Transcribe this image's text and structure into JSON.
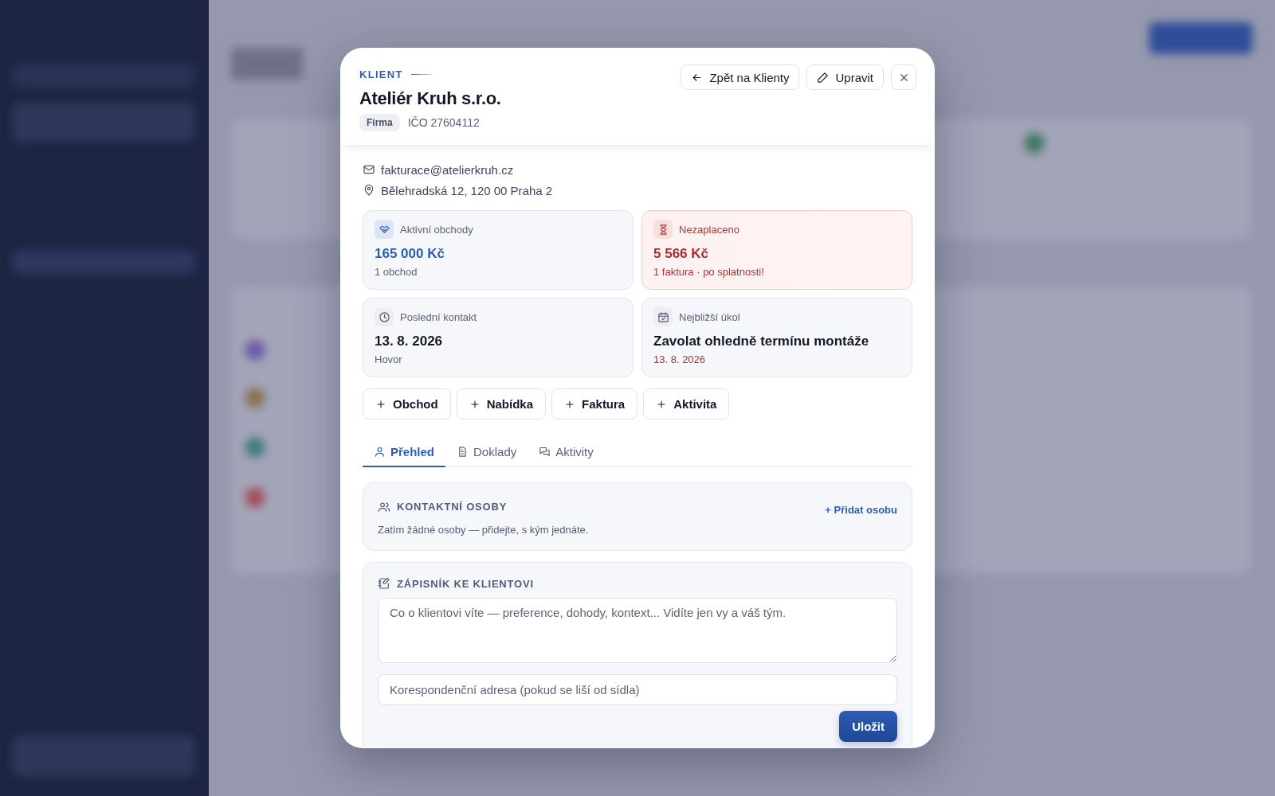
{
  "header": {
    "eyebrow": "KLIENT",
    "title": "Ateliér Kruh s.r.o.",
    "type_badge": "Firma",
    "ico": "IČO 27604112",
    "buttons": [
      {
        "kind": "back",
        "label": "Zpět na Klienty"
      },
      {
        "kind": "edit",
        "label": "Upravit"
      },
      {
        "kind": "close"
      }
    ]
  },
  "contact": [
    {
      "kind": "email",
      "text": "fakturace@atelierkruh.cz"
    },
    {
      "kind": "address",
      "text": "Bělehradská 12, 120 00 Praha 2"
    }
  ],
  "stats": [
    {
      "kind": "deals",
      "label": "Aktivní obchody",
      "value": "165 000 Kč",
      "note": "1 obchod"
    },
    {
      "kind": "unpaid",
      "label": "Nezaplaceno",
      "value": "5 566 Kč",
      "note": "1 faktura · po splatnosti!"
    },
    {
      "kind": "contact",
      "label": "Poslední kontakt",
      "value": "13. 8. 2026",
      "note": "Hovor"
    },
    {
      "kind": "task",
      "label": "Nejbližší úkol",
      "value": "Zavolat ohledně termínu montáže",
      "note": "13. 8. 2026"
    }
  ],
  "actions": [
    {
      "label": "Obchod"
    },
    {
      "label": "Nabídka"
    },
    {
      "label": "Faktura"
    },
    {
      "label": "Aktivita"
    }
  ],
  "tabs": [
    {
      "kind": "overview",
      "label": "Přehled",
      "selected": true
    },
    {
      "kind": "documents",
      "label": "Doklady",
      "selected": false
    },
    {
      "kind": "activities",
      "label": "Aktivity",
      "selected": false
    }
  ],
  "contacts_section": {
    "title": "KONTAKTNÍ OSOBY",
    "link": "+ Přidat osobu",
    "empty": "Zatím žádné osoby — přidejte, s kým jednáte."
  },
  "notes_section": {
    "title": "ZÁPISNÍK KE KLIENTOVI",
    "notes_field": {
      "placeholder": "Co o klientovi víte — preference, dohody, kontext... Vidíte jen vy a váš tým."
    },
    "address_field": {
      "placeholder": "Korespondenční adresa (pokud se liší od sídla)"
    },
    "save": "Uložit"
  }
}
